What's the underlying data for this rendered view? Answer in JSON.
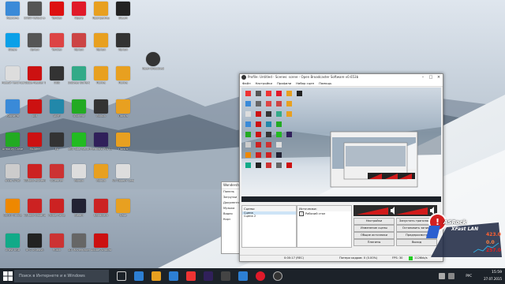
{
  "colors": {
    "taskbar": "#1c2229",
    "obs_bg": "#f0f0f0",
    "accent_red": "#d32020",
    "meter_red": "#d11a1a"
  },
  "desktop_icons": [
    {
      "label": "Корзина",
      "color": "#3a8ad8",
      "icon": "recycle-bin-icon"
    },
    {
      "label": "COSO Fallout в облаке",
      "color": "#555",
      "icon": "app-icon"
    },
    {
      "label": "Yandex",
      "color": "#d11",
      "icon": "yandex-icon"
    },
    {
      "label": "Opera",
      "color": "#e01a2a",
      "icon": "opera-icon"
    },
    {
      "label": "Программы",
      "color": "#e8a020",
      "icon": "folder-icon"
    },
    {
      "label": "Steam",
      "color": "#222",
      "icon": "steam-icon"
    },
    {
      "label": "Skype",
      "color": "#0aa0e8",
      "icon": "skype-icon"
    },
    {
      "label": "ярлык",
      "color": "#555",
      "icon": "app-icon"
    },
    {
      "label": "Yandex",
      "color": "#d44",
      "icon": "yandex-icon"
    },
    {
      "label": "Ярлык",
      "color": "#c44",
      "icon": "app-icon"
    },
    {
      "label": "Ярлык",
      "color": "#e8a020",
      "icon": "folder-icon"
    },
    {
      "label": "Ярлык",
      "color": "#333",
      "icon": "app-icon"
    },
    {
      "label": "Open Broadcaster",
      "color": "#333",
      "icon": "obs-icon"
    },
    {
      "label": "Новый текстовый",
      "color": "#ddd",
      "icon": "text-file-icon"
    },
    {
      "label": "Adobe Reader 9",
      "color": "#c11",
      "icon": "pdf-icon"
    },
    {
      "label": "OBS",
      "color": "#333",
      "icon": "obs-icon"
    },
    {
      "label": "Subway Surfers",
      "color": "#3a8",
      "icon": "game-icon"
    },
    {
      "label": "Папка",
      "color": "#e8a020",
      "icon": "folder-icon"
    },
    {
      "label": "Папка",
      "color": "#e8a020",
      "icon": "folder-icon"
    },
    {
      "label": "Корзина",
      "color": "#3a8ad8",
      "icon": "recycle-bin-icon"
    },
    {
      "label": "pdf",
      "color": "#c11",
      "icon": "pdf-icon"
    },
    {
      "label": "AIMP",
      "color": "#28a",
      "icon": "aimp-icon"
    },
    {
      "label": "uTorrent",
      "color": "#2a2",
      "icon": "utorrent-icon"
    },
    {
      "label": "Ярлык",
      "color": "#333",
      "icon": "app-icon"
    },
    {
      "label": "Папка",
      "color": "#e8a020",
      "icon": "folder-icon"
    },
    {
      "label": "Armoury Crate",
      "color": "#2a2",
      "icon": "app-icon"
    },
    {
      "label": "McAfee",
      "color": "#c11",
      "icon": "mcafee-icon"
    },
    {
      "label": "EA",
      "color": "#333",
      "icon": "ea-icon"
    },
    {
      "label": "360 Total Security",
      "color": "#2b2",
      "icon": "app-icon"
    },
    {
      "label": "Premiere Pro CC",
      "color": "#30205a",
      "icon": "premiere-icon"
    },
    {
      "label": "Папка",
      "color": "#e8a020",
      "icon": "folder-icon"
    },
    {
      "label": "srcip-3736",
      "color": "#ccc",
      "icon": "file-icon"
    },
    {
      "label": "ASRock eXtreme",
      "color": "#c22",
      "icon": "asrock-icon"
    },
    {
      "label": "CCleaner",
      "color": "#c33",
      "icon": "ccleaner-icon"
    },
    {
      "label": "Ярлык",
      "color": "#ddd",
      "icon": "file-icon"
    },
    {
      "label": "Ярлык",
      "color": "#e8a020",
      "icon": "folder-icon"
    },
    {
      "label": "VE Проект Lets",
      "color": "#ddd",
      "icon": "file-icon"
    },
    {
      "label": "CSGO Online",
      "color": "#e80",
      "icon": "csgo-icon"
    },
    {
      "label": "ASRock InstantBoot",
      "color": "#c22",
      "icon": "asrock-icon"
    },
    {
      "label": "Police Force",
      "color": "#c22",
      "icon": "game-icon"
    },
    {
      "label": "Steam",
      "color": "#223",
      "icon": "steam-icon"
    },
    {
      "label": "Bandicam",
      "color": "#c22",
      "icon": "bandicam-icon"
    },
    {
      "label": "Data",
      "color": "#e8a020",
      "icon": "folder-icon"
    },
    {
      "label": "XFast USB",
      "color": "#1a8",
      "icon": "app-icon"
    },
    {
      "label": "UFC Unleash",
      "color": "#222",
      "icon": "app-icon"
    },
    {
      "label": "Rubik",
      "color": "#c33",
      "icon": "game-icon"
    },
    {
      "label": "3D Moviemaker",
      "color": "#666",
      "icon": "app-icon"
    },
    {
      "label": "Adobe Acrobat",
      "color": "#c11",
      "icon": "pdf-icon"
    }
  ],
  "obs": {
    "title": "Profile: Untitled - Scenes: scene - Open Broadcaster Software v0.653b",
    "menu": [
      "Файл",
      "Настройки",
      "Профили",
      "Набор сцен",
      "Помощь"
    ],
    "scenes_header": "Сцены:",
    "scenes": [
      "Сцена",
      "Сцена 2"
    ],
    "sources_header": "Источники:",
    "sources": [
      "Рабочий стол"
    ],
    "buttons": [
      "Настройки",
      "Запустить трансляцию",
      "Изменение сцены",
      "Остановить запись",
      "Общие источники",
      "Предпросмотр",
      "Плагины",
      "Выход"
    ],
    "status": {
      "time": "0:00:17 (REC)",
      "dropped": "Потери кадров: 0 (0.00%)",
      "fps": "FPS: 30",
      "bitrate": "1126kb/s"
    }
  },
  "explorer": {
    "title": "Wondershare",
    "items": [
      "Панель",
      "Загрузки",
      "Документы",
      "Музыка",
      "Видео",
      "Корз"
    ]
  },
  "widget": {
    "brand": "ASRock",
    "brand2": "XFast LAN",
    "v1": "423.0",
    "v2": "0.0",
    "v3": "257.0"
  },
  "taskbar": {
    "search_placeholder": "Поиск в Интернете и в Windows",
    "lang": "РУС",
    "time": "15:59",
    "date": "27.07.2015"
  }
}
